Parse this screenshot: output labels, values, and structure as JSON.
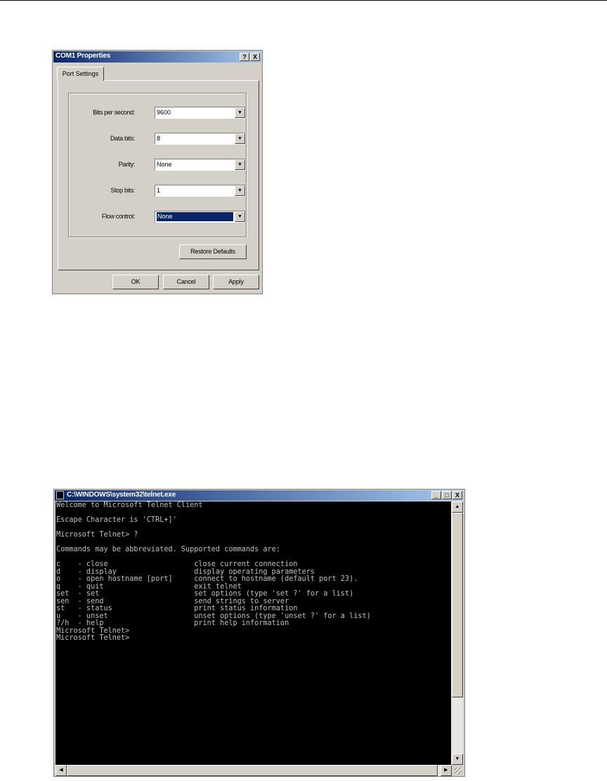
{
  "com1_dialog": {
    "title": "COM1 Properties",
    "help_label": "?",
    "close_label": "X",
    "tab_label": "Port Settings",
    "fields": [
      {
        "label": "Bits per second:",
        "value": "9600"
      },
      {
        "label": "Data bits:",
        "value": "8"
      },
      {
        "label": "Parity:",
        "value": "None"
      },
      {
        "label": "Stop bits:",
        "value": "1"
      },
      {
        "label": "Flow control:",
        "value": "None"
      }
    ],
    "restore_label": "Restore Defaults",
    "ok_label": "OK",
    "cancel_label": "Cancel",
    "apply_label": "Apply"
  },
  "telnet_window": {
    "title": "C:\\WINDOWS\\system32\\telnet.exe",
    "minimize_label": "_",
    "maximize_label": "□",
    "close_label": "X",
    "console_text": "Welcome to Microsoft Telnet Client\n\nEscape Character is 'CTRL+]'\n\nMicrosoft Telnet> ?\n\nCommands may be abbreviated. Supported commands are:\n\nc    - close                    close current connection\nd    - display                  display operating parameters\no    - open hostname [port]     connect to hostname (default port 23).\nq    - quit                     exit telnet\nset  - set                      set options (type 'set ?' for a list)\nsen  - send                     send strings to server\nst   - status                   print status information\nu    - unset                    unset options (type 'unset ?' for a list)\n?/h  - help                     print help information\nMicrosoft Telnet>\nMicrosoft Telnet>"
  }
}
